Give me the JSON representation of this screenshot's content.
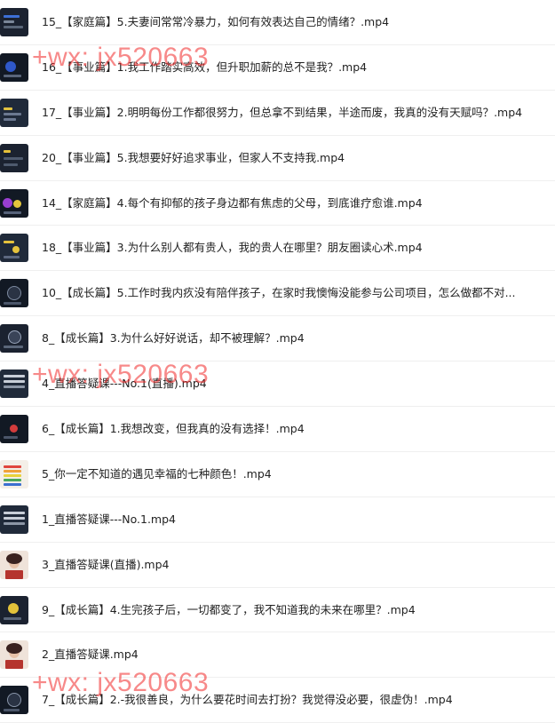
{
  "files": [
    {
      "name": "15_【家庭篇】5.夫妻间常常冷暴力，如何有效表达自己的情绪？.mp4",
      "thumb": "video-thumbnail"
    },
    {
      "name": "16_【事业篇】1.我工作踏实高效，但升职加薪的总不是我？.mp4",
      "thumb": "video-thumbnail"
    },
    {
      "name": "17_【事业篇】2.明明每份工作都很努力，但总拿不到结果，半途而废，我真的没有天赋吗？.mp4",
      "thumb": "video-thumbnail"
    },
    {
      "name": "20_【事业篇】5.我想要好好追求事业，但家人不支持我.mp4",
      "thumb": "video-thumbnail"
    },
    {
      "name": "14_【家庭篇】4.每个有抑郁的孩子身边都有焦虑的父母，到底谁疗愈谁.mp4",
      "thumb": "video-thumbnail"
    },
    {
      "name": "18_【事业篇】3.为什么别人都有贵人，我的贵人在哪里？朋友圈读心术.mp4",
      "thumb": "video-thumbnail"
    },
    {
      "name": "10_【成长篇】5.工作时我内疚没有陪伴孩子，在家时我懊悔没能参与公司项目，怎么做都不对...",
      "thumb": "video-thumbnail"
    },
    {
      "name": "8_【成长篇】3.为什么好好说话，却不被理解？.mp4",
      "thumb": "video-thumbnail"
    },
    {
      "name": "4_直播答疑课---No.1(直播).mp4",
      "thumb": "video-thumbnail"
    },
    {
      "name": "6_【成长篇】1.我想改变，但我真的没有选择！.mp4",
      "thumb": "video-thumbnail"
    },
    {
      "name": "5_你一定不知道的遇见幸福的七种颜色！.mp4",
      "thumb": "video-thumbnail"
    },
    {
      "name": "1_直播答疑课---No.1.mp4",
      "thumb": "video-thumbnail"
    },
    {
      "name": "3_直播答疑课(直播).mp4",
      "thumb": "video-thumbnail"
    },
    {
      "name": "9_【成长篇】4.生完孩子后，一切都变了，我不知道我的未来在哪里？.mp4",
      "thumb": "video-thumbnail"
    },
    {
      "name": "2_直播答疑课.mp4",
      "thumb": "video-thumbnail"
    },
    {
      "name": "7_【成长篇】2.-我很善良，为什么要花时间去打扮？我觉得没必要，很虚伪！.mp4",
      "thumb": "video-thumbnail"
    }
  ],
  "watermark": {
    "text": "+wx: jx520663",
    "color": "#f02828"
  }
}
